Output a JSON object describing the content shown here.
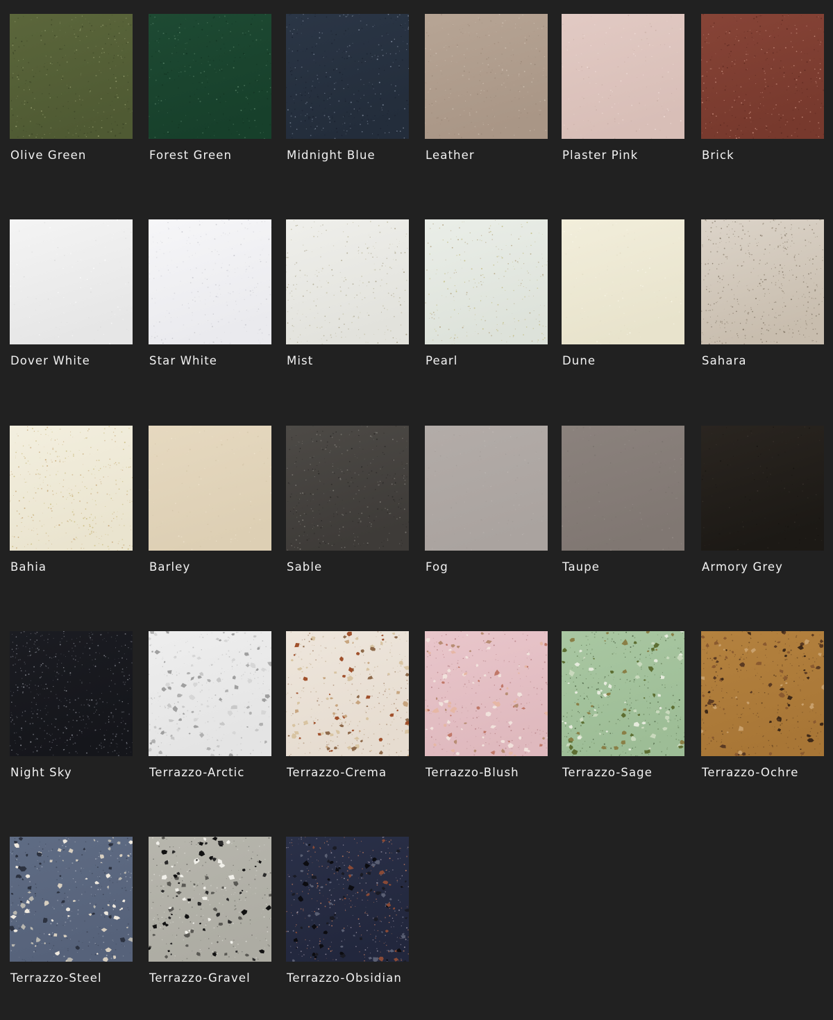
{
  "swatches": [
    {
      "name": "Olive Green",
      "base": "#5b663b",
      "shade": "#4f5a33",
      "speck": [
        "#8f9868",
        "#3e4728"
      ],
      "density": 0.06,
      "chip": "none"
    },
    {
      "name": "Forest Green",
      "base": "#1e4a33",
      "shade": "#17402b",
      "speck": [
        "#4f7a60",
        "#133523"
      ],
      "density": 0.05,
      "chip": "none"
    },
    {
      "name": "Midnight Blue",
      "base": "#2b3646",
      "shade": "#232d3b",
      "speck": [
        "#7a8597",
        "#1b2230"
      ],
      "density": 0.07,
      "chip": "none"
    },
    {
      "name": "Leather",
      "base": "#b7a595",
      "shade": "#a99686",
      "speck": [
        "#9c8979",
        "#cbbcad"
      ],
      "density": 0.05,
      "chip": "none"
    },
    {
      "name": "Plaster Pink",
      "base": "#e2cac4",
      "shade": "#d8beb7",
      "speck": [
        "#c9aea6",
        "#f0ddd8"
      ],
      "density": 0.03,
      "chip": "none"
    },
    {
      "name": "Brick",
      "base": "#874437",
      "shade": "#77392d",
      "speck": [
        "#c18676",
        "#5e2a21"
      ],
      "density": 0.07,
      "chip": "none"
    },
    {
      "name": "Dover White",
      "base": "#f4f4f4",
      "shade": "#e6e6e6",
      "speck": [
        "#dddddd",
        "#ffffff"
      ],
      "density": 0.02,
      "chip": "none"
    },
    {
      "name": "Star White",
      "base": "#f6f6f8",
      "shade": "#eaeaee",
      "speck": [
        "#c9c9cf",
        "#dcdce2"
      ],
      "density": 0.05,
      "chip": "none"
    },
    {
      "name": "Mist",
      "base": "#efefeb",
      "shade": "#e2e2dc",
      "speck": [
        "#c6c2a8",
        "#a9a38a"
      ],
      "density": 0.05,
      "chip": "none"
    },
    {
      "name": "Pearl",
      "base": "#eaeee8",
      "shade": "#dde2da",
      "speck": [
        "#c6c08a",
        "#b7a888"
      ],
      "density": 0.05,
      "chip": "none"
    },
    {
      "name": "Dune",
      "base": "#f2eedb",
      "shade": "#e8e3cc",
      "speck": [
        "#e0dac2",
        "#f8f5e6"
      ],
      "density": 0.02,
      "chip": "none"
    },
    {
      "name": "Sahara",
      "base": "#dcd4c9",
      "shade": "#c8bdae",
      "speck": [
        "#9b8f7e",
        "#7d7262"
      ],
      "density": 0.09,
      "chip": "none"
    },
    {
      "name": "Bahia",
      "base": "#f3efdf",
      "shade": "#eae4cf",
      "speck": [
        "#cdbf85",
        "#c8a979"
      ],
      "density": 0.07,
      "chip": "none"
    },
    {
      "name": "Barley",
      "base": "#e6d9c0",
      "shade": "#ddcfb4",
      "speck": [
        "#d4c5a8",
        "#eee3cd"
      ],
      "density": 0.02,
      "chip": "none"
    },
    {
      "name": "Sable",
      "base": "#4d4a46",
      "shade": "#3e3b38",
      "speck": [
        "#7b7872",
        "#2c2a28"
      ],
      "density": 0.07,
      "chip": "none"
    },
    {
      "name": "Fog",
      "base": "#b3aca8",
      "shade": "#aaa39f",
      "speck": [
        "#a39c98",
        "#bcb6b2"
      ],
      "density": 0.02,
      "chip": "none"
    },
    {
      "name": "Taupe",
      "base": "#8b827d",
      "shade": "#807772",
      "speck": [
        "#7a726d",
        "#958d88"
      ],
      "density": 0.02,
      "chip": "none"
    },
    {
      "name": "Armory Grey",
      "base": "#2a2520",
      "shade": "#1c1915",
      "speck": [
        "#3a342e",
        "#171411"
      ],
      "density": 0.02,
      "chip": "none"
    },
    {
      "name": "Night Sky",
      "base": "#1b1c22",
      "shade": "#15161b",
      "speck": [
        "#8d8f98",
        "#5b5d66"
      ],
      "density": 0.09,
      "chip": "none"
    },
    {
      "name": "Terrazzo-Arctic",
      "base": "#eeeeee",
      "shade": "#e4e4e4",
      "speck": [
        "#b8b8b8",
        "#cfcfcf"
      ],
      "density": 0.04,
      "chip": [
        "#b0b0b0",
        "#c8c8c8",
        "#9f9f9f",
        "#d6d6d6"
      ]
    },
    {
      "name": "Terrazzo-Crema",
      "base": "#eee6dc",
      "shade": "#e6dcd0",
      "speck": [
        "#c9b89e",
        "#a88970"
      ],
      "density": 0.05,
      "chip": [
        "#a0502b",
        "#d8c4a2",
        "#c7a57f",
        "#8e6a4b"
      ]
    },
    {
      "name": "Terrazzo-Blush",
      "base": "#e9c6cb",
      "shade": "#dfb9be",
      "speck": [
        "#c69ca1",
        "#b58084"
      ],
      "density": 0.05,
      "chip": [
        "#c07868",
        "#f1e2dc",
        "#b88d74",
        "#e6b7a5"
      ]
    },
    {
      "name": "Terrazzo-Sage",
      "base": "#a9c7a2",
      "shade": "#9dbd96",
      "speck": [
        "#6f8a63",
        "#4c6243"
      ],
      "density": 0.06,
      "chip": [
        "#5d6e32",
        "#e6ebdd",
        "#8a7f46",
        "#c9d9bd"
      ]
    },
    {
      "name": "Terrazzo-Ochre",
      "base": "#b4823f",
      "shade": "#a87636",
      "speck": [
        "#7a5229",
        "#5c3d1e"
      ],
      "density": 0.05,
      "chip": [
        "#5a3a22",
        "#3d2817",
        "#8a5a2f",
        "#c8a06c"
      ]
    },
    {
      "name": "Terrazzo-Steel",
      "base": "#5f6c84",
      "shade": "#56627a",
      "speck": [
        "#a7aebb",
        "#3c4456"
      ],
      "density": 0.05,
      "chip": [
        "#d8cfc0",
        "#b9b7b0",
        "#2c3240",
        "#efe9df"
      ]
    },
    {
      "name": "Terrazzo-Gravel",
      "base": "#b7b6ad",
      "shade": "#adaca3",
      "speck": [
        "#6f6e68",
        "#d7d6cf"
      ],
      "density": 0.05,
      "chip": [
        "#111111",
        "#2a2a2a",
        "#f1f0ea",
        "#5a5954"
      ]
    },
    {
      "name": "Terrazzo-Obsidian",
      "base": "#2a3048",
      "shade": "#22273d",
      "speck": [
        "#9a93a4",
        "#c07b5e"
      ],
      "density": 0.07,
      "chip": [
        "#0c0c10",
        "#1a1b24",
        "#8a4a36",
        "#5a5f73"
      ]
    }
  ]
}
